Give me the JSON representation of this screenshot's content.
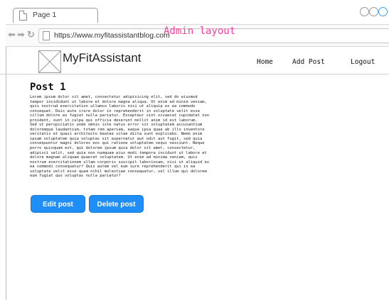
{
  "browser": {
    "tab_title": "Page 1",
    "url": "https://www.myfitassistantblog.com"
  },
  "annotation": "Admin layout",
  "header": {
    "brand": "MyFitAssistant",
    "menu": [
      "Home",
      "Add Post",
      "Logout"
    ]
  },
  "post": {
    "title": "Post 1",
    "body": "Lorem ipsum dolor sit amet, consectetur adipisicing elit, sed do eiusmod\ntempor incididunt ut labore et dolore magna aliqua. Ut enim ad minim veniam,\nquis nostrud exercitation ullamco laboris nisi ut aliquip ex ea commodo\nconsequat. Duis aute irure dolor in reprehenderit in voluptate velit esse\ncillum dolore eu fugiat nulla pariatur. Excepteur sint occaecat cupidatat non\nproident, sunt in culpa qui officia deserunt mollit anim id est laborum.\nSed ut perspiciatis unde omnis iste natus error sit voluptatem accusantium\ndoloremque laudantium, totam rem aperiam, eaque ipsa quae ab illo inventore\nveritatis et quasi architecto beatae vitae dicta sunt explicabo. Nemo enim\nipsam voluptatem quia voluptas sit aspernatur aut odit aut fugit, sed quia\nconsequuntur magni dolores eos qui ratione voluptatem sequi nesciunt. Neque\nporro quisquam est, qui dolorem ipsum quia dolor sit amet, consectetur,\nadipisci velit, sed quia non numquam eius modi tempora incidunt ut labore et\ndolore magnam aliquam quaerat voluptatem. Ut enim ad minima veniam, quis\nnostrum exercitationem ullam corporis suscipit laboriosam, nisi ut aliquid ex\nea commodi consequatur? Quis autem vel eum iure reprehenderit qui in ea\nvoluptate velit esse quam nihil molestiae consequatur, vel illum qui dolorem\neum fugiat quo voluptas nulla pariatur?",
    "edit_label": "Edit post",
    "delete_label": "Delete post"
  },
  "icons": {
    "back": "arrow-left-icon",
    "forward": "arrow-right-icon",
    "reload": "reload-icon",
    "page": "page-icon",
    "logo": "image-placeholder-icon"
  },
  "colors": {
    "accent": "#1f8ff7",
    "annotation": "#ff3d9f"
  }
}
